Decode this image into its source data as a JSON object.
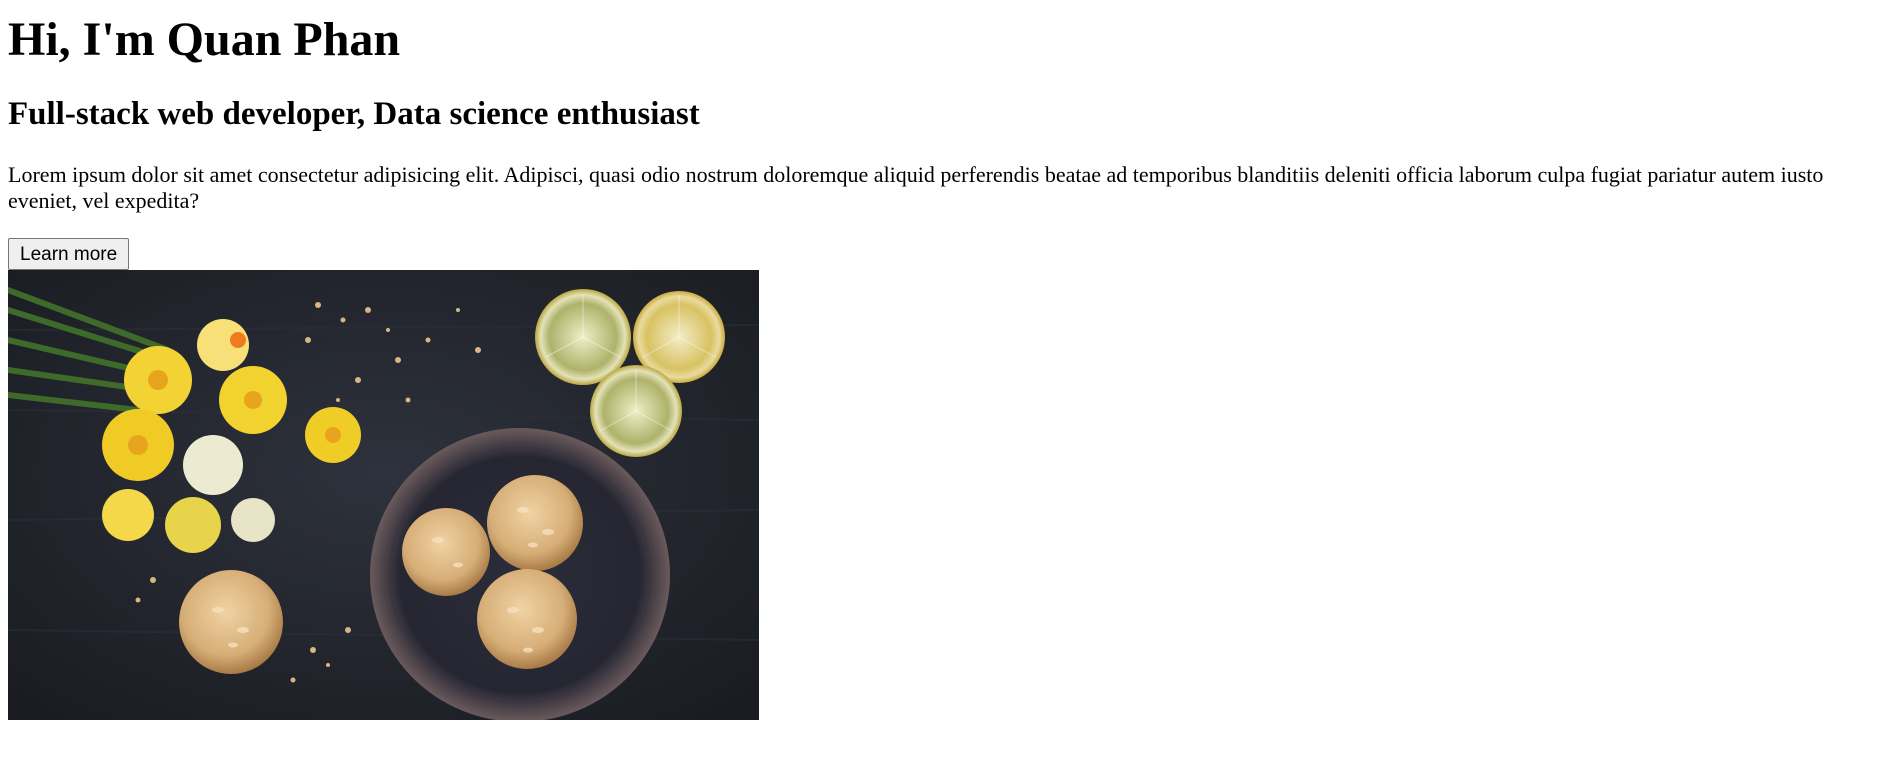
{
  "hero": {
    "title": "Hi, I'm Quan Phan",
    "subtitle": "Full-stack web developer, Data science enthusiast",
    "description": "Lorem ipsum dolor sit amet consectetur adipisicing elit. Adipisci, quasi odio nostrum doloremque aliquid perferendis beatae ad temporibus blanditiis deleniti officia laborum culpa fugiat pariatur autem iusto eveniet, vel expedita?",
    "button_label": "Learn more",
    "image_icon": "photo-food-flowers"
  },
  "colors": {
    "image_background": "#22252d",
    "flower_yellow": "#f2cf2a",
    "lemon": "#e8d774",
    "cookie": "#d8b07a"
  }
}
